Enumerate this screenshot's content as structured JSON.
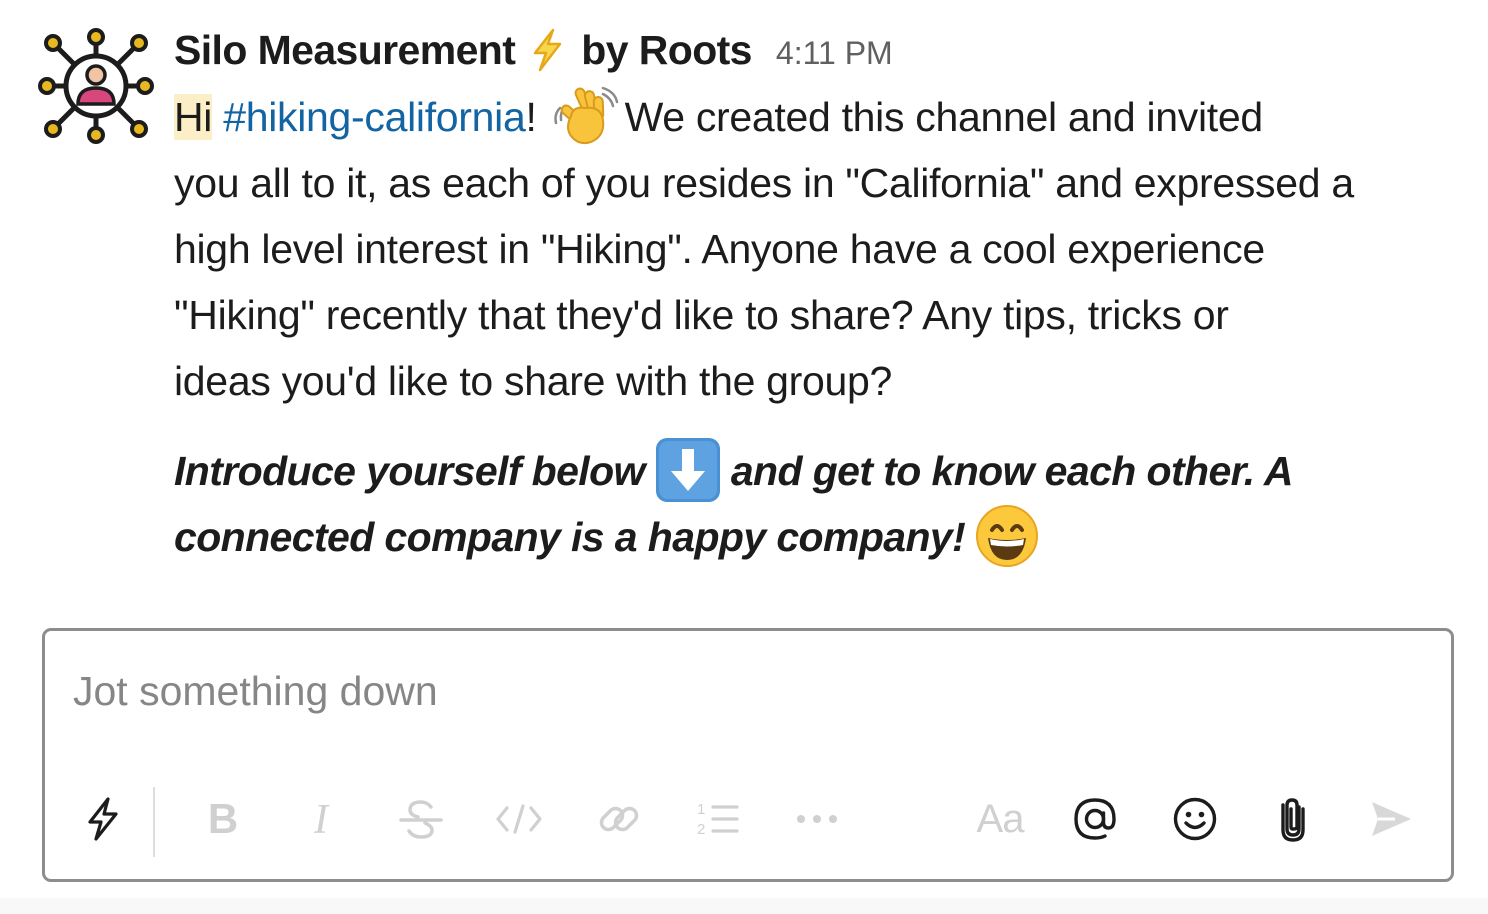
{
  "message": {
    "sender": "Silo Measurement",
    "sender_suffix": "by Roots",
    "timestamp": "4:11 PM",
    "greeting": "Hi",
    "channel": "#hiking-california",
    "line1_tail": "We created this channel and invited",
    "line2": "you all to it, as each of you resides in \"California\" and expressed a",
    "line3": "high level interest in \"Hiking\". Anyone have a cool experience",
    "line4": "\"Hiking\" recently that they'd like to share? Any tips, tricks or",
    "line5": "ideas you'd like to share with the group?",
    "intro_a": "Introduce yourself below",
    "intro_b": "and get to know each other. A",
    "intro_c": "connected company is a happy company!"
  },
  "composer": {
    "placeholder": "Jot something down",
    "text_style_label": "Aa"
  },
  "icons": [
    "bot-avatar-icon",
    "lightning-bolt-icon",
    "waving-hand-icon",
    "down-arrow-icon",
    "grinning-face-icon",
    "shortcuts-icon",
    "bold-icon",
    "italic-icon",
    "strikethrough-icon",
    "code-icon",
    "link-icon",
    "ordered-list-icon",
    "more-icon",
    "mention-icon",
    "emoji-icon",
    "attach-icon",
    "send-icon"
  ],
  "colors": {
    "channel_link": "#1264a3",
    "highlight": "#fcefc7",
    "avatar_accent": "#e8b820",
    "avatar_person": "#d9467d",
    "toolbar_disabled": "#d0d0d0",
    "toolbar_active": "#1d1c1d"
  }
}
